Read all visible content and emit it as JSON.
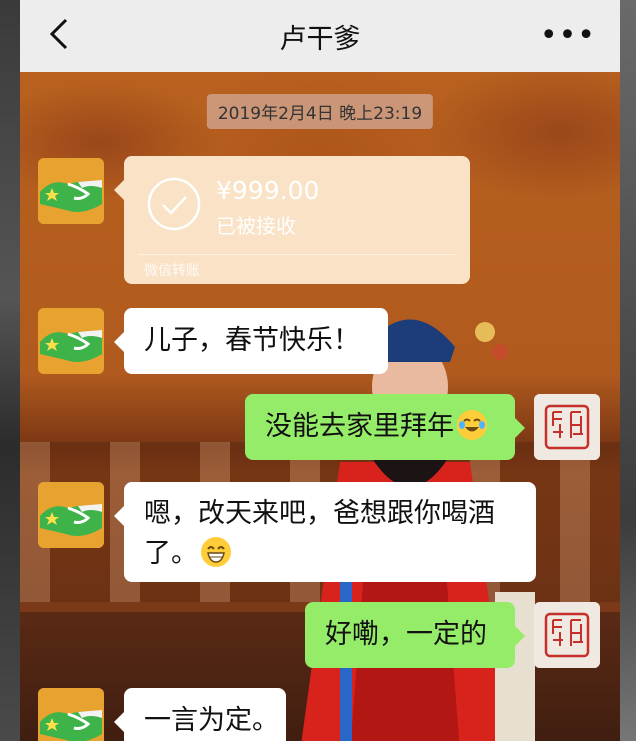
{
  "header": {
    "title": "卢干爹"
  },
  "chat": {
    "timestamp": "2019年2月4日 晚上23:19",
    "transfer": {
      "amount": "¥999.00",
      "status": "已被接收",
      "type": "微信转账"
    },
    "messages": [
      {
        "side": "left",
        "text": "儿子，春节快乐！"
      },
      {
        "side": "right",
        "text": "没能去家里拜年",
        "emoji": "laughing-tears-emoji"
      },
      {
        "side": "left",
        "line1": "嗯，改天来吧，爸想跟你喝酒",
        "line2": "了。",
        "emoji": "grinning-emoji"
      },
      {
        "side": "right",
        "text": "好嘞，一定的"
      },
      {
        "side": "left",
        "text": "一言为定。"
      }
    ]
  },
  "colors": {
    "header_bg": "#ededed",
    "green_bubble": "#95ec69",
    "white_bubble": "#ffffff",
    "transfer_bubble": "#f9e2c6"
  },
  "icons": [
    "back-arrow-icon",
    "more-dots-icon",
    "handshake-avatar",
    "seal-avatar",
    "check-circle-icon"
  ]
}
